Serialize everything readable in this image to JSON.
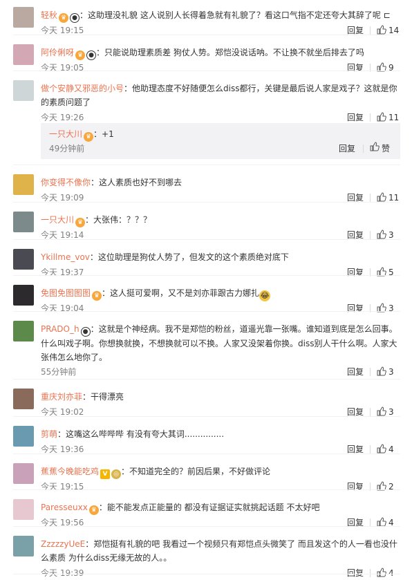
{
  "ui": {
    "reply_label": "回复",
    "like_label": "赞"
  },
  "comments": [
    {
      "id": "c1",
      "username": "轻秋",
      "badges": [
        "vip-gold",
        "panda"
      ],
      "text": "：这助理没礼貌 这人说别人长得着急就有礼貌了？看这口气指不定还夸大其辞了呢 ⊏",
      "time": "今天 19:15",
      "likes": "14"
    },
    {
      "id": "c2",
      "username": "阿伶俐呀",
      "badges": [
        "vip-gold",
        "panda"
      ],
      "text": "：只能说助理素质差 狗仗人势。郑恺没说话呐。不让换不就坐后排去了吗",
      "time": "今天 19:05",
      "likes": "9"
    },
    {
      "id": "c3",
      "username": "做个安静又邪恶的小号",
      "badges": [],
      "text": "：他助理态度不好随便怎么diss都行，关键是最后说人家是戏子？这就是你的素质问题了",
      "time": "今天 19:26",
      "likes": "11",
      "sub_reply": {
        "username": "一只大川",
        "badges": [
          "vip-gold"
        ],
        "text": "：+1",
        "time": "49分钟前"
      }
    },
    {
      "id": "c4",
      "username": "你变得不像你",
      "badges": [],
      "text": "：这人素质也好不到哪去",
      "time": "今天 19:09",
      "likes": "11"
    },
    {
      "id": "c5",
      "username": "一只大川",
      "badges": [
        "vip-gold"
      ],
      "text": "：大张伟：？？？",
      "time": "今天 19:14",
      "likes": "3"
    },
    {
      "id": "c6",
      "username": "Ykillme_vov",
      "badges": [],
      "text": "：这位助理是狗仗人势了，但发文的这个素质绝对底下",
      "time": "今天 19:37",
      "likes": "5"
    },
    {
      "id": "c7",
      "username": "免图免图图图",
      "badges": [
        "vip-gold"
      ],
      "text": "：这人挺可爱啊，又不是刘亦菲跟古力娜扎",
      "emoji": "laugh-cry",
      "time": "今天 19:04",
      "likes": "3"
    },
    {
      "id": "c8",
      "username": "PRADO_h",
      "badges": [
        "panda"
      ],
      "text": "：这就是个神经病。我不是郑恺的粉丝，道遥光靠一张嘴。谁知道到底是怎么回事。什么叫戏子啊。你想换就换，不想换就可以不换。人家又没架着你换。diss别人干什么啊。人家大张伟怎么地你了。",
      "time": "55分钟前",
      "likes": "3"
    },
    {
      "id": "c9",
      "username": "重庆刘亦菲",
      "badges": [],
      "text": "：干得漂亮",
      "time": "今天 19:02",
      "likes": "3"
    },
    {
      "id": "c10",
      "username": "剪萌",
      "badges": [],
      "text": "：这嘴这么哔哔哔  有没有夸大其词...............",
      "time": "今天 19:36",
      "likes": "4"
    },
    {
      "id": "c11",
      "username": "蕉蕉今晚能吃鸡",
      "badges": [
        "v-yellow",
        "gold-medal"
      ],
      "text": "：不知道完全的？前因后果，不好做评论",
      "time": "今天 19:15",
      "likes": "2"
    },
    {
      "id": "c12",
      "username": "Paresseuxx",
      "badges": [
        "vip-gold"
      ],
      "text": "：能不能发点正能量的 都没有证据证实就挑起话题 不太好吧",
      "time": "今天 19:56",
      "likes": "4"
    },
    {
      "id": "c13",
      "username": "ZzzzzyUeE",
      "badges": [],
      "text": "：郑恺挺有礼貌的吧 我看过一个视频只有郑恺点头微笑了 而且发这个的人一看也没什么素质 为什么diss无缘无故的人。。",
      "time": "今天 19:39",
      "likes": "4"
    }
  ],
  "avatar_colors": [
    "#b9a9a0",
    "#d4a7b5",
    "#cfd6d8",
    "#e0b24a",
    "#7c8a8c",
    "#4a4a52",
    "#2d2a2e",
    "#5b8a4a",
    "#8a6a5a",
    "#6a9ab0",
    "#c9a1b8",
    "#e8c8d0",
    "#7aa0a8"
  ]
}
